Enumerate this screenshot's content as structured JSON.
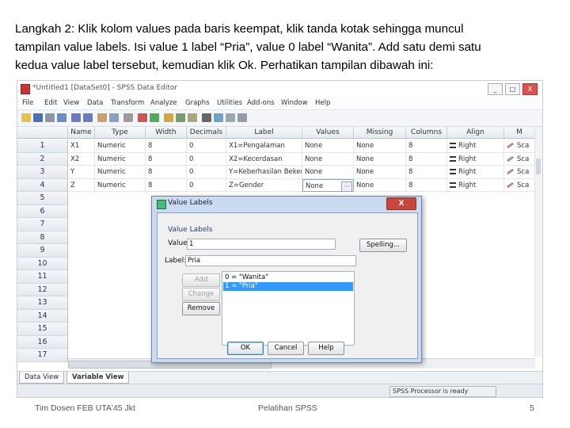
{
  "intro": {
    "line1": "Langkah 2: Klik kolom values pada baris keempat, klik tanda kotak sehingga muncul",
    "line2": "tampilan value labels. Isi value 1 label “Pria”, value 0 label “Wanita”. Add satu demi satu",
    "line3": "kedua value label tersebut, kemudian klik Ok. Perhatikan tampilan dibawah ini:"
  },
  "window": {
    "title": "*Untitled1 [DataSet0] - SPSS Data Editor",
    "buttons": [
      "_",
      "□",
      "X"
    ]
  },
  "menu": [
    "File",
    "Edit",
    "View",
    "Data",
    "Transform",
    "Analyze",
    "Graphs",
    "Utilities",
    "Add-ons",
    "Window",
    "Help"
  ],
  "grid": {
    "columns": [
      "Name",
      "Type",
      "Width",
      "Decimals",
      "Label",
      "Values",
      "Missing",
      "Columns",
      "Align",
      "M"
    ],
    "row_numbers": [
      "1",
      "2",
      "3",
      "4",
      "5",
      "6",
      "7",
      "8",
      "9",
      "10",
      "11",
      "12",
      "13",
      "14",
      "15",
      "16",
      "17"
    ],
    "rows": [
      {
        "name": "X1",
        "type": "Numeric",
        "width": "8",
        "decimals": "0",
        "label": "X1=Pengalaman",
        "values": "None",
        "missing": "None",
        "columns": "8",
        "align": "Right",
        "measure": "Sca"
      },
      {
        "name": "X2",
        "type": "Numeric",
        "width": "8",
        "decimals": "0",
        "label": "X2=Kecerdasan",
        "values": "None",
        "missing": "None",
        "columns": "8",
        "align": "Right",
        "measure": "Sca"
      },
      {
        "name": "Y",
        "type": "Numeric",
        "width": "8",
        "decimals": "0",
        "label": "Y=Keberhasilan Bekerja",
        "values": "None",
        "missing": "None",
        "columns": "8",
        "align": "Right",
        "measure": "Sca"
      },
      {
        "name": "Z",
        "type": "Numeric",
        "width": "8",
        "decimals": "0",
        "label": "Z=Gender",
        "values": "None",
        "missing": "None",
        "columns": "8",
        "align": "Right",
        "measure": "Sca"
      }
    ]
  },
  "tabs": {
    "data_view": "Data View",
    "variable_view": "Variable View"
  },
  "status": {
    "processor": "SPSS Processor is ready"
  },
  "dialog": {
    "title": "Value Labels",
    "close": "X",
    "group_label": "Value Labels",
    "value_label": "Value:",
    "value": "1",
    "label_label": "Label:",
    "label": "Pria",
    "spelling": "Spelling...",
    "add": "Add",
    "change": "Change",
    "remove": "Remove",
    "list": [
      "0 = \"Wanita\"",
      "1 = \"Pria\""
    ],
    "ok": "OK",
    "cancel": "Cancel",
    "help": "Help"
  },
  "footer": {
    "left": "Tim Dosen FEB UTA'45 Jkt",
    "center": "Pelatihan SPSS",
    "page": "5"
  }
}
